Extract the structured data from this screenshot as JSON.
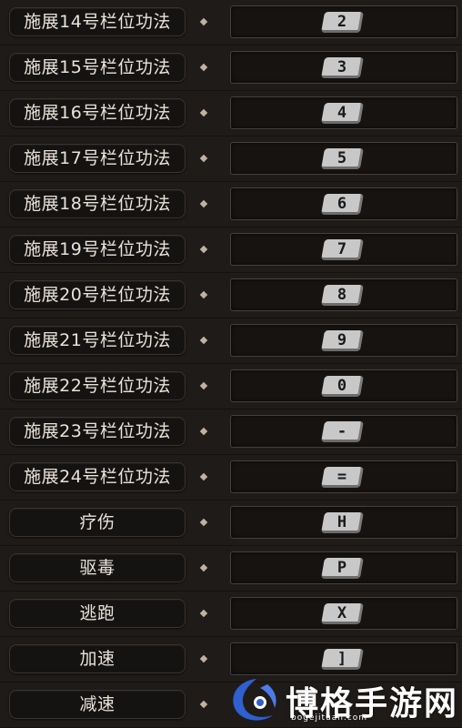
{
  "keybindings": [
    {
      "label": "施展14号栏位功法",
      "key": "2"
    },
    {
      "label": "施展15号栏位功法",
      "key": "3"
    },
    {
      "label": "施展16号栏位功法",
      "key": "4"
    },
    {
      "label": "施展17号栏位功法",
      "key": "5"
    },
    {
      "label": "施展18号栏位功法",
      "key": "6"
    },
    {
      "label": "施展19号栏位功法",
      "key": "7"
    },
    {
      "label": "施展20号栏位功法",
      "key": "8"
    },
    {
      "label": "施展21号栏位功法",
      "key": "9"
    },
    {
      "label": "施展22号栏位功法",
      "key": "0"
    },
    {
      "label": "施展23号栏位功法",
      "key": "-"
    },
    {
      "label": "施展24号栏位功法",
      "key": "="
    },
    {
      "label": "疗伤",
      "key": "H"
    },
    {
      "label": "驱毒",
      "key": "P"
    },
    {
      "label": "逃跑",
      "key": "X"
    },
    {
      "label": "加速",
      "key": "]"
    },
    {
      "label": "减速",
      "key": ""
    }
  ],
  "watermark": {
    "title": "博格手游网",
    "url": "bogejituan.com"
  },
  "colors": {
    "background": "#1f1b18",
    "label_text": "#e9e2d9",
    "keycap": "#c8c8c8",
    "watermark_blue": "#2f5fd0"
  }
}
